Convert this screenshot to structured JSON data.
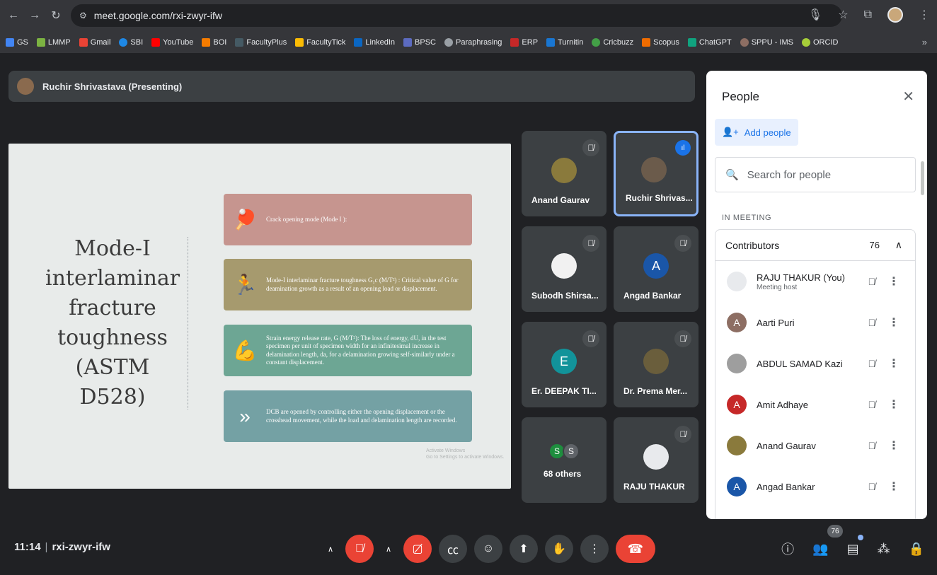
{
  "browser": {
    "url": "meet.google.com/rxi-zwyr-ifw",
    "bookmarks": [
      "GS",
      "LMMP",
      "Gmail",
      "SBI",
      "YouTube",
      "BOI",
      "FacultyPlus",
      "FacultyTick",
      "LinkedIn",
      "BPSC",
      "Paraphrasing",
      "ERP",
      "Turnitin",
      "Cricbuzz",
      "Scopus",
      "ChatGPT",
      "SPPU - IMS",
      "ORCID"
    ],
    "more": "»"
  },
  "presenter": {
    "label": "Ruchir Shrivastava (Presenting)"
  },
  "slide": {
    "title": "Mode-I interlaminar fracture toughness (ASTM D528)",
    "cards": [
      "Crack opening mode (Mode I ):",
      "Mode-I interlaminar fracture toughness G₁c (M/T²) : Critical value of G for deamination growth as a result of an opening load or displacement.",
      "Strain energy release rate, G (M/T²): The loss of energy, dU, in the test specimen per unit of specimen width for an infinitesimal increase in delamination length, da, for a delamination growing self-similarly under a constant displacement.",
      "DCB are opened by controlling either the opening displacement or the crosshead movement, while the load and delamination length are recorded."
    ],
    "watermark_1": "Activate Windows",
    "watermark_2": "Go to Settings to activate Windows."
  },
  "tiles": {
    "t1": "Anand Gaurav",
    "t2": "Ruchir Shrivas...",
    "t3": "Subodh Shirsa...",
    "t4": "Angad Bankar",
    "t4_initial": "A",
    "t5": "Er. DEEPAK TI...",
    "t5_initial": "E",
    "t6": "Dr. Prema Mer...",
    "t7": "68 others",
    "t7_d1": "S",
    "t7_d2": "S",
    "t8": "RAJU THAKUR"
  },
  "people": {
    "title": "People",
    "add_label": "Add people",
    "search_placeholder": "Search for people",
    "section": "IN MEETING",
    "group": "Contributors",
    "count": "76",
    "rows": [
      {
        "name": "RAJU THAKUR (You)",
        "sub": "Meeting host",
        "initial": ""
      },
      {
        "name": "Aarti Puri",
        "sub": "",
        "initial": "A"
      },
      {
        "name": "ABDUL SAMAD Kazi",
        "sub": "",
        "initial": ""
      },
      {
        "name": "Amit Adhaye",
        "sub": "",
        "initial": "A"
      },
      {
        "name": "Anand Gaurav",
        "sub": "",
        "initial": ""
      },
      {
        "name": "Angad Bankar",
        "sub": "",
        "initial": "A"
      }
    ]
  },
  "bottom": {
    "time": "11:14",
    "meeting_code": "rxi-zwyr-ifw",
    "participant_badge": "76"
  }
}
